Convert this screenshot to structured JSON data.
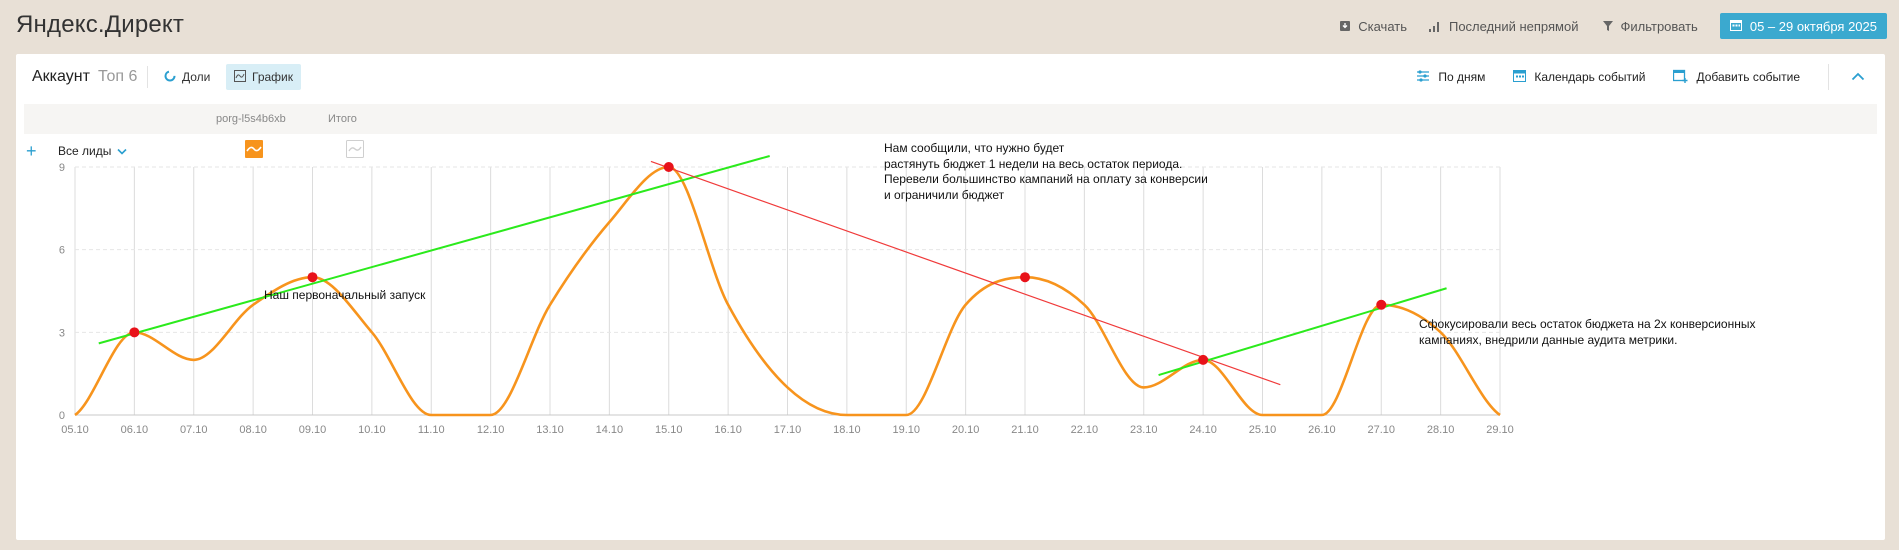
{
  "app": {
    "title": "Яндекс.Директ"
  },
  "toolbar": {
    "download": "Скачать",
    "attribution": "Последний непрямой",
    "filter": "Фильтровать",
    "date_range": "05 – 29 октября 2025"
  },
  "panel": {
    "title": "Аккаунт",
    "subtitle": "Топ 6",
    "shares_label": "Доли",
    "graph_label": "График",
    "by_days": "По дням",
    "events_calendar": "Календарь событий",
    "add_event": "Добавить событие"
  },
  "table": {
    "columns": [
      "porg-l5s4b6xb",
      "Итого"
    ],
    "metric_select": "Все лиды"
  },
  "colors": {
    "series": "#f7941d",
    "trend_up": "#2bea1c",
    "trend_down": "#f03a3a",
    "marker": "#e8121a",
    "accent": "#3ba9cf"
  },
  "chart_data": {
    "type": "line",
    "x": [
      "05.10",
      "06.10",
      "07.10",
      "08.10",
      "09.10",
      "10.10",
      "11.10",
      "12.10",
      "13.10",
      "14.10",
      "15.10",
      "16.10",
      "17.10",
      "18.10",
      "19.10",
      "20.10",
      "21.10",
      "22.10",
      "23.10",
      "24.10",
      "25.10",
      "26.10",
      "27.10",
      "28.10",
      "29.10"
    ],
    "series": [
      {
        "name": "porg-l5s4b6xb",
        "values": [
          0,
          3,
          2,
          4,
          5,
          3,
          0,
          0,
          4,
          7,
          9,
          4,
          1,
          0,
          0,
          4,
          5,
          4,
          1,
          2,
          0,
          0,
          4,
          3,
          0
        ]
      }
    ],
    "yticks": [
      0,
      3,
      6,
      9
    ],
    "ylim": [
      0,
      9
    ],
    "grid": true,
    "markers": [
      {
        "x": "06.10",
        "y": 3
      },
      {
        "x": "09.10",
        "y": 5
      },
      {
        "x": "15.10",
        "y": 9
      },
      {
        "x": "21.10",
        "y": 5
      },
      {
        "x": "24.10",
        "y": 2
      },
      {
        "x": "27.10",
        "y": 4
      }
    ],
    "trendlines": [
      {
        "kind": "up",
        "from": {
          "x": 5.4,
          "y": 2.6
        },
        "to": {
          "x": 16.7,
          "y": 9.4
        }
      },
      {
        "kind": "down",
        "from": {
          "x": 14.7,
          "y": 9.2
        },
        "to": {
          "x": 25.3,
          "y": 1.1
        }
      },
      {
        "kind": "up",
        "from": {
          "x": 23.25,
          "y": 1.45
        },
        "to": {
          "x": 28.1,
          "y": 4.6
        }
      }
    ],
    "annotations": [
      "Наш первоначальный запуск",
      "Нам сообщили, что нужно будет\nрастянуть бюджет 1 недели на весь остаток периода.\nПеревели большинство кампаний на оплату за конверсии\nи ограничили бюджет",
      "Сфокусировали весь остаток бюджета на 2х конверсионных\nкампаниях, внедрили данные аудита метрики."
    ]
  }
}
